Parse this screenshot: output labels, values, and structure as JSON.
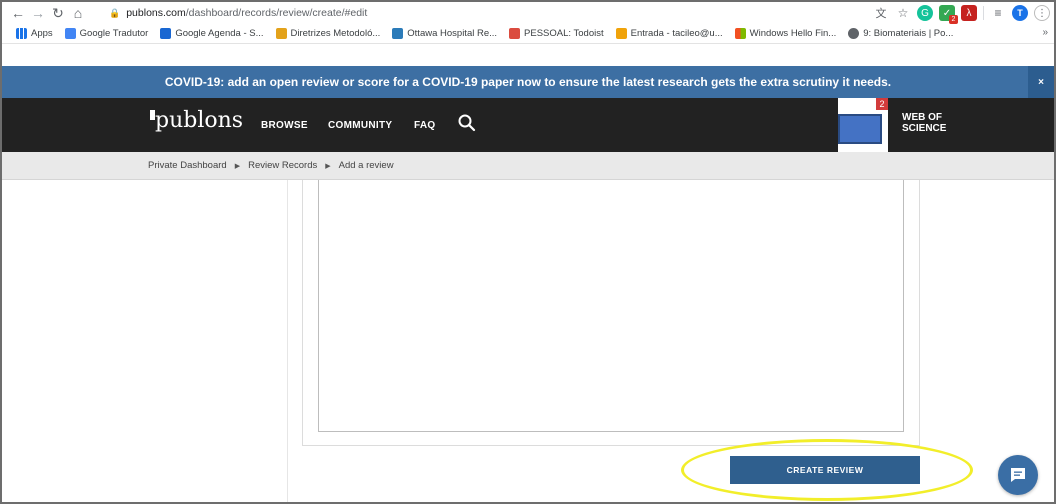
{
  "browser": {
    "url_host": "publons.com",
    "url_path": "/dashboard/records/review/create/#edit",
    "avatar_letter": "T",
    "ext_badge": "2"
  },
  "bookmarks": [
    {
      "label": "Apps",
      "color": "#1a73e8"
    },
    {
      "label": "Google Tradutor",
      "color": "#4285f4"
    },
    {
      "label": "Google Agenda - S...",
      "color": "#1967d2"
    },
    {
      "label": "Diretrizes Metodoló...",
      "color": "#e3a21a"
    },
    {
      "label": "Ottawa Hospital Re...",
      "color": "#2b7bb9"
    },
    {
      "label": "PESSOAL: Todoist",
      "color": "#db4c3f"
    },
    {
      "label": "Entrada - tacileo@u...",
      "color": "#f0a30a"
    },
    {
      "label": "Windows Hello Fin...",
      "color": "#00a4ef"
    },
    {
      "label": "9: Biomateriais | Po...",
      "color": "#5f6368"
    }
  ],
  "bookmarks_more": "»",
  "banner": {
    "text": "COVID-19: add an open review or score for a COVID-19 paper now to ensure the latest research gets the extra scrutiny it needs.",
    "close": "×"
  },
  "header": {
    "logo": "publons",
    "nav": [
      "BROWSE",
      "COMMUNITY",
      "FAQ"
    ],
    "ad_badge": "2",
    "wos_line1": "WEB OF",
    "wos_line2": "SCIENCE"
  },
  "breadcrumb": [
    "Private Dashboard",
    "Review Records",
    "Add a review"
  ],
  "form": {
    "textarea_value": "",
    "submit_label": "CREATE REVIEW"
  },
  "colors": {
    "banner": "#3d6fa3",
    "header": "#222222",
    "button": "#2f5f8e",
    "highlight": "#f2ee2a"
  }
}
